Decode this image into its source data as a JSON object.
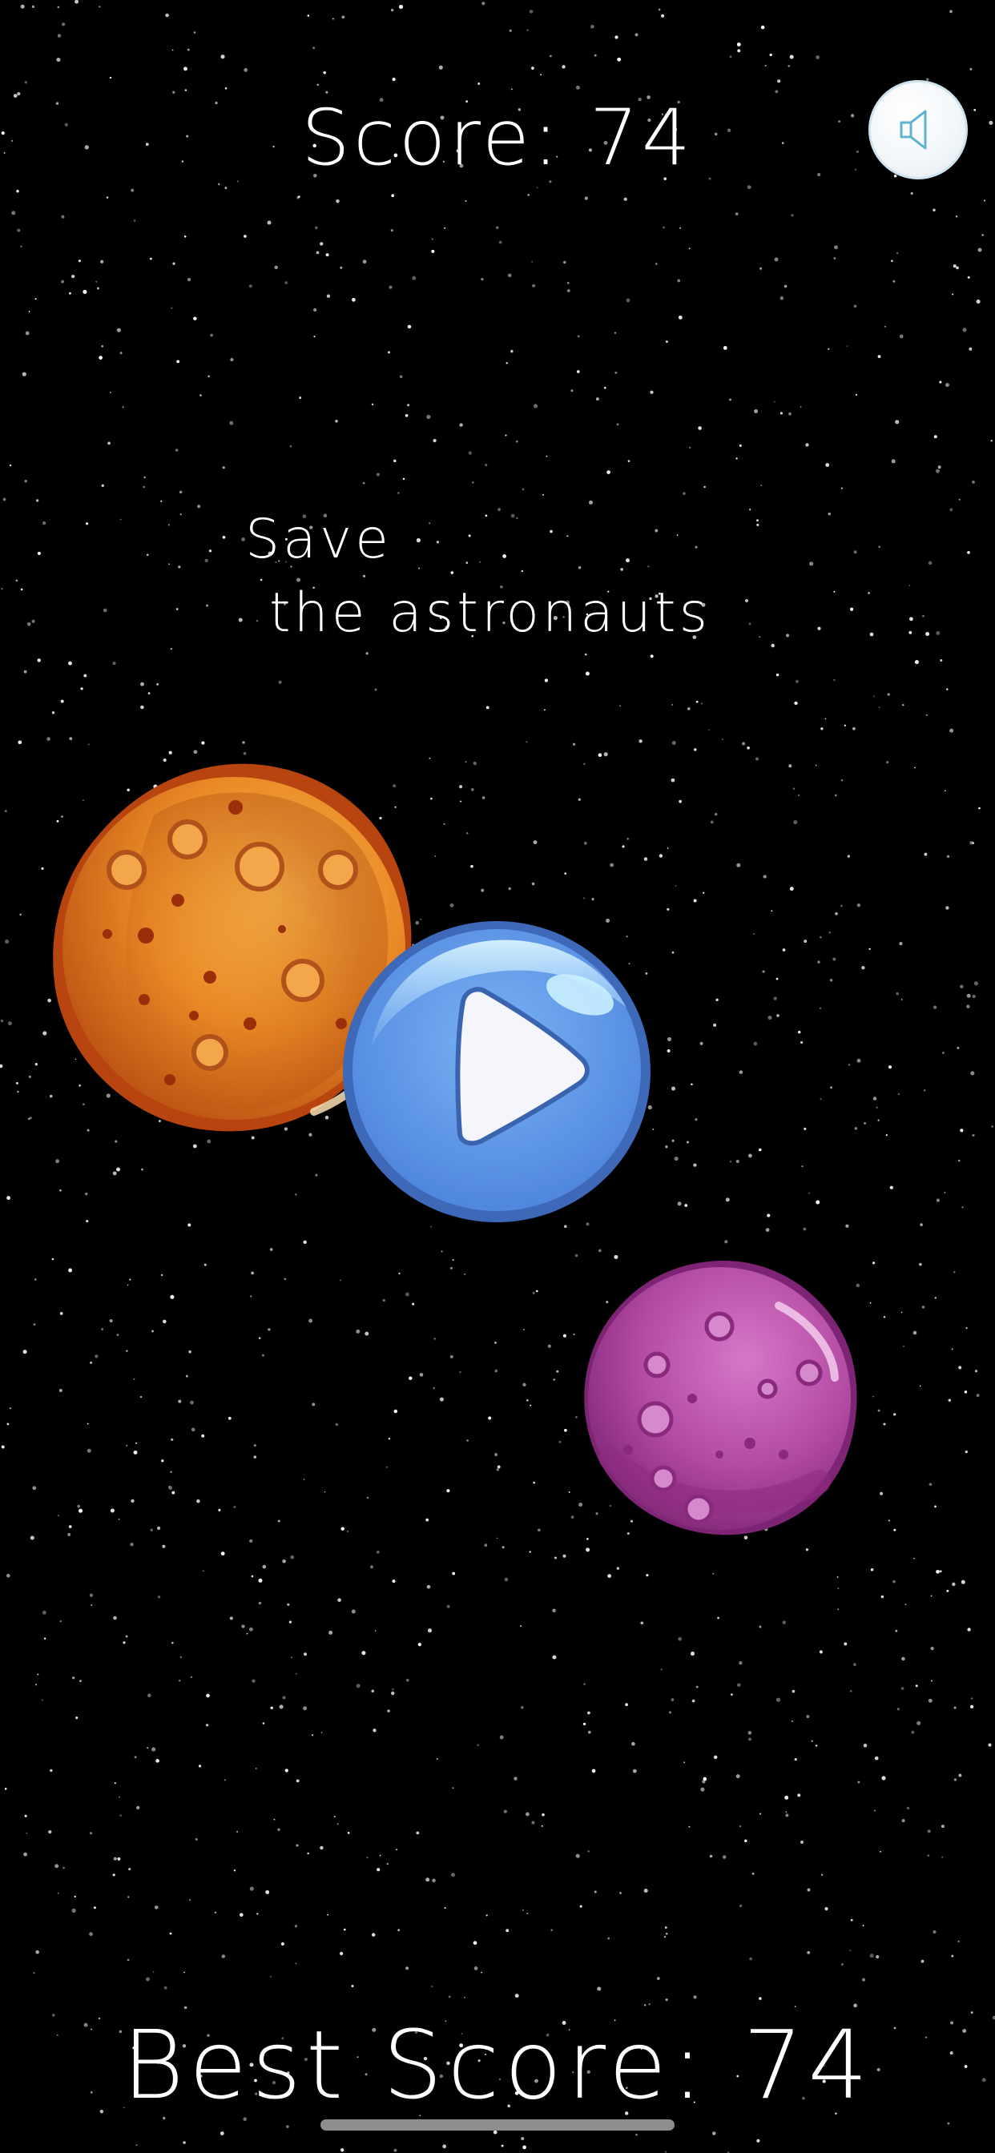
{
  "score_text": "Score: 74",
  "tagline": {
    "line1": "Save",
    "line2": "the astronauts"
  },
  "best_score_text": "Best Score: 74",
  "sound_button": {
    "icon": "speaker-icon"
  },
  "play_button": {
    "icon": "play-icon"
  },
  "colors": {
    "background": "#000000",
    "text": "#ffffff",
    "play_blue": "#5b95e6",
    "orange_planet": "#e8892a",
    "purple_planet": "#b0489f"
  }
}
